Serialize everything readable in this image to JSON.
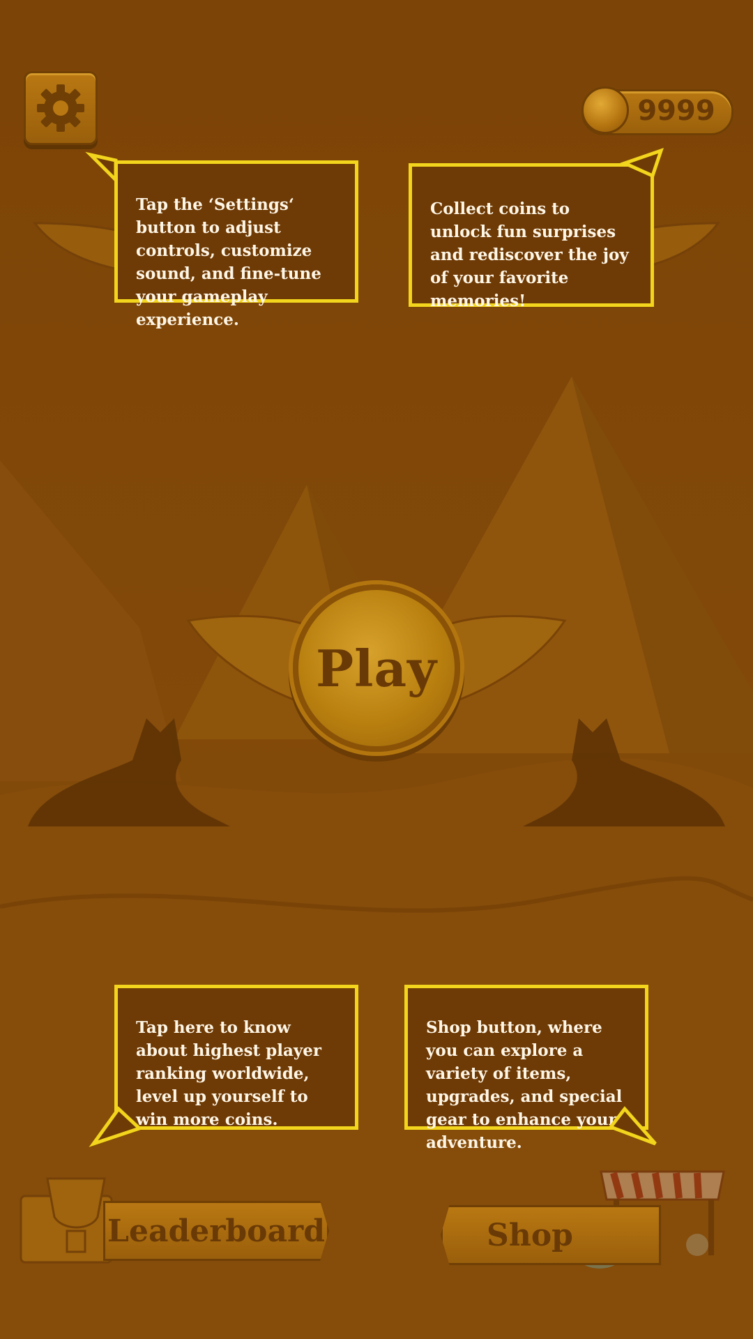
{
  "colors": {
    "tooltip_bg": "#6e3a05",
    "tooltip_border": "#f2d51c",
    "tooltip_text": "#fff6e6",
    "button_gold": "#b97812",
    "button_text": "#6a3a06"
  },
  "header": {
    "settings_icon": "gear-icon",
    "coins": {
      "icon": "coin-icon",
      "value": "9999"
    }
  },
  "main": {
    "play_label": "Play"
  },
  "footer": {
    "leaderboard_label": "Leaderboard",
    "leaderboard_icon": "trophy-icon",
    "shop_label": "Shop",
    "shop_icon": "market-stall-icon"
  },
  "tutorial": {
    "settings_tip": "Tap the ‘Settings‘ button to adjust controls, customize sound, and fine-tune your gameplay experience.",
    "coins_tip": "Collect coins to unlock fun surprises and rediscover the joy of your favorite memories!",
    "leaderboard_tip": "Tap here to know about highest player ranking worldwide, level up yourself to win more coins.",
    "shop_tip": "Shop button, where you can explore a variety of items, upgrades, and special gear to enhance your adventure."
  }
}
